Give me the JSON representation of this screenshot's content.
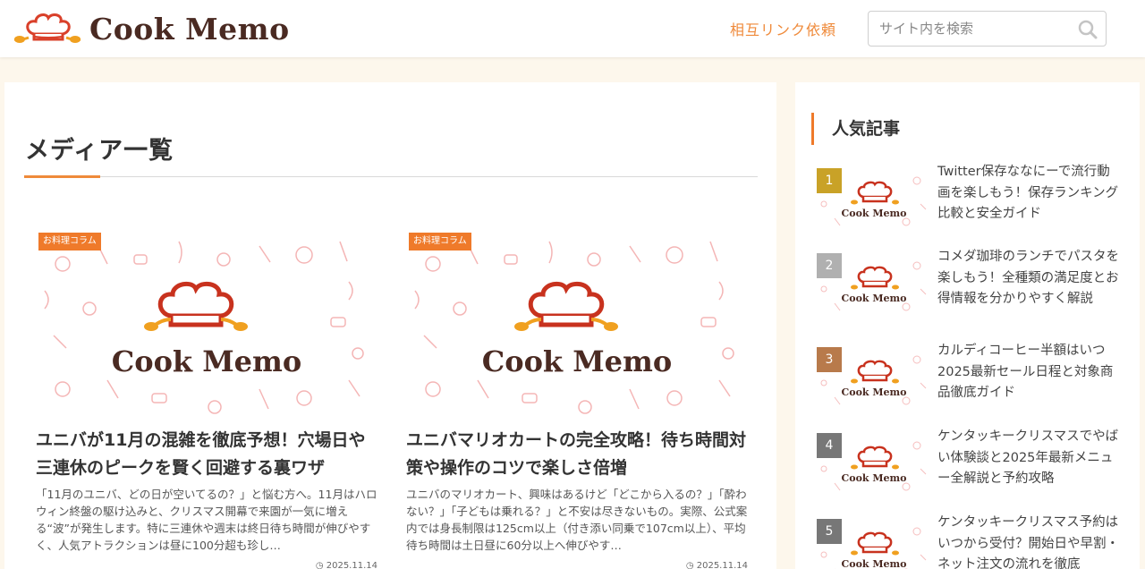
{
  "header": {
    "logo_text": "Cook Memo",
    "link_label": "相互リンク依頼",
    "search_placeholder": "サイト内を検索"
  },
  "main": {
    "title": "メディア一覧",
    "cards": [
      {
        "category": "お料理コラム",
        "thumb_text": "Cook Memo",
        "title": "ユニバが11月の混雑を徹底予想！穴場日や三連休のピークを賢く回避する裏ワザ",
        "excerpt": "「11月のユニバ、どの日が空いてるの？」と悩む方へ。11月はハロウィン終盤の駆け込みと、クリスマス開幕で来園が一気に増える“波”が発生します。特に三連休や週末は終日待ち時間が伸びやすく、人気アトラクションは昼に100分超も珍し…",
        "date": "2025.11.14"
      },
      {
        "category": "お料理コラム",
        "thumb_text": "Cook Memo",
        "title": "ユニバマリオカートの完全攻略！待ち時間対策や操作のコツで楽しさ倍増",
        "excerpt": "ユニバのマリオカート、興味はあるけど「どこから入るの？」「酔わない？」「子どもは乗れる？」と不安は尽きないもの。実際、公式案内では身長制限は125cm以上（付き添い同乗で107cm以上）、平均待ち時間は土日昼に60分以上へ伸びやす…",
        "date": "2025.11.14"
      }
    ]
  },
  "sidebar": {
    "heading": "人気記事",
    "thumb_text": "Cook Memo",
    "items": [
      {
        "rank": "1",
        "color": "#c9a227",
        "title": "Twitter保存ななにーで流行動画を楽しもう！保存ランキング比較と安全ガイド"
      },
      {
        "rank": "2",
        "color": "#b0b0b0",
        "title": "コメダ珈琲のランチでパスタを楽しもう！全種類の満足度とお得情報を分かりやすく解説"
      },
      {
        "rank": "3",
        "color": "#b87a4b",
        "title": "カルディコーヒー半額はいつ2025最新セール日程と対象商品徹底ガイド"
      },
      {
        "rank": "4",
        "color": "#777777",
        "title": "ケンタッキークリスマスでやばい体験談と2025年最新メニュー全解説と予約攻略"
      },
      {
        "rank": "5",
        "color": "#777777",
        "title": "ケンタッキークリスマス予約はいつから受付？開始日や早割・ネット注文の流れを徹底"
      }
    ]
  },
  "colors": {
    "accent": "#ef8a3a",
    "badge": "#ef7a2a",
    "brand_brown": "#4a2a22"
  }
}
